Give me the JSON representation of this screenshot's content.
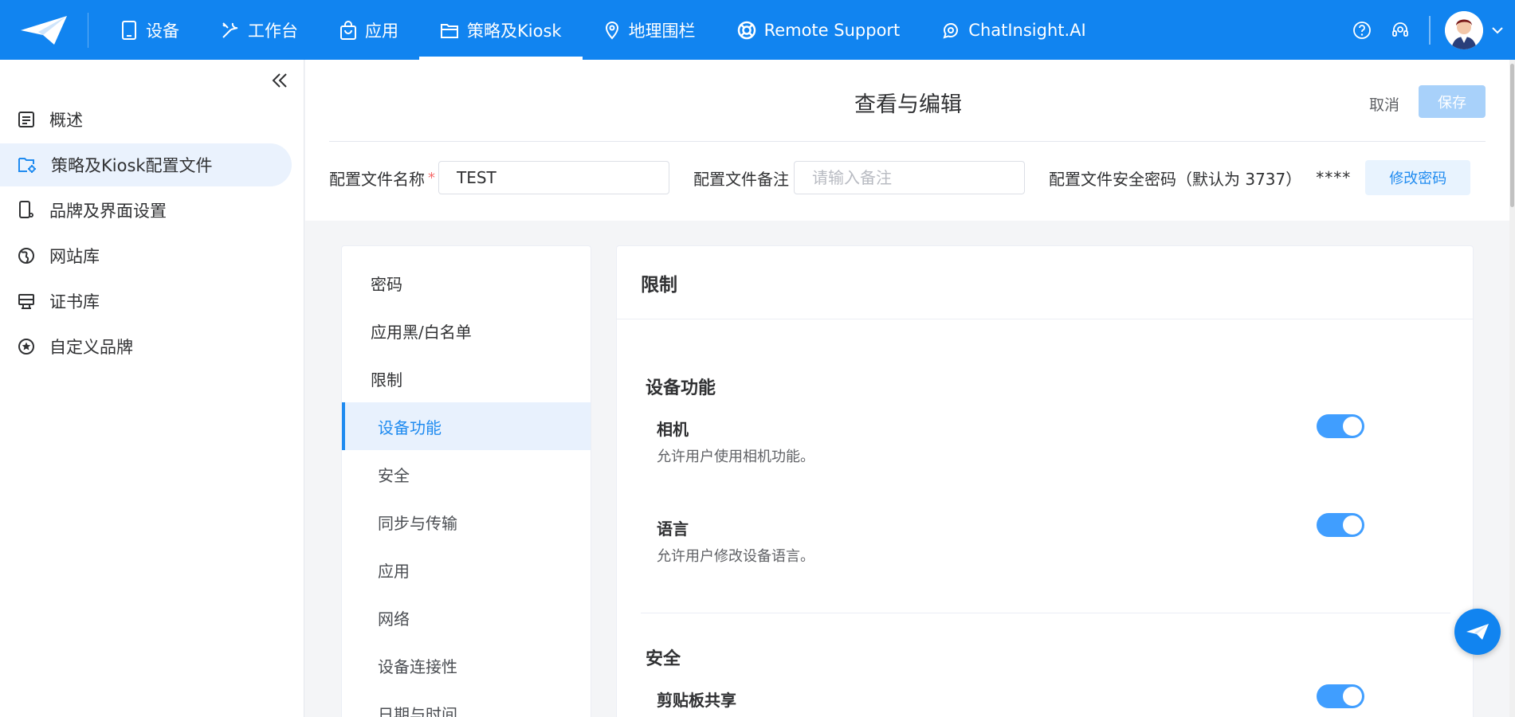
{
  "nav": {
    "items": [
      {
        "label": "设备",
        "icon": "tablet-icon"
      },
      {
        "label": "工作台",
        "icon": "tools-icon"
      },
      {
        "label": "应用",
        "icon": "shopping-bag-icon"
      },
      {
        "label": "策略及Kiosk",
        "icon": "folder-icon"
      },
      {
        "label": "地理围栏",
        "icon": "location-pin-icon"
      },
      {
        "label": "Remote Support",
        "icon": "lifebuoy-icon"
      },
      {
        "label": "ChatInsight.AI",
        "icon": "ai-chat-icon"
      }
    ],
    "active": "策略及Kiosk"
  },
  "sidebar": {
    "items": [
      {
        "label": "概述",
        "icon": "overview-icon"
      },
      {
        "label": "策略及Kiosk配置文件",
        "icon": "folder-settings-icon"
      },
      {
        "label": "品牌及界面设置",
        "icon": "device-settings-icon"
      },
      {
        "label": "网站库",
        "icon": "globe-icon"
      },
      {
        "label": "证书库",
        "icon": "certificate-icon"
      },
      {
        "label": "自定义品牌",
        "icon": "star-badge-icon"
      }
    ],
    "active": "策略及Kiosk配置文件"
  },
  "header": {
    "title": "查看与编辑",
    "cancel_label": "取消",
    "save_label": "保存"
  },
  "form": {
    "name_label": "配置文件名称",
    "required_mark": "*",
    "name_value": "TEST",
    "note_label": "配置文件备注",
    "note_placeholder": "请输入备注",
    "password_label": "配置文件安全密码（默认为 3737）",
    "password_mask": "****",
    "change_password_label": "修改密码"
  },
  "settings_menu": {
    "items": [
      {
        "label": "密码",
        "level": 1
      },
      {
        "label": "应用黑/白名单",
        "level": 1
      },
      {
        "label": "限制",
        "level": 1
      },
      {
        "label": "设备功能",
        "level": 2
      },
      {
        "label": "安全",
        "level": 2
      },
      {
        "label": "同步与传输",
        "level": 2
      },
      {
        "label": "应用",
        "level": 2
      },
      {
        "label": "网络",
        "level": 2
      },
      {
        "label": "设备连接性",
        "level": 2
      },
      {
        "label": "日期与时间",
        "level": 2
      }
    ],
    "active": "设备功能"
  },
  "content": {
    "title": "限制",
    "sections": [
      {
        "title": "设备功能",
        "options": [
          {
            "title": "相机",
            "desc": "允许用户使用相机功能。",
            "enabled": true
          },
          {
            "title": "语言",
            "desc": "允许用户修改设备语言。",
            "enabled": true
          }
        ]
      },
      {
        "title": "安全",
        "options": [
          {
            "title": "剪贴板共享",
            "enabled": true
          }
        ]
      }
    ]
  },
  "colors": {
    "brand": "#1184f0",
    "toggle_on": "#409eff",
    "active_bg": "#eaf2fd"
  }
}
